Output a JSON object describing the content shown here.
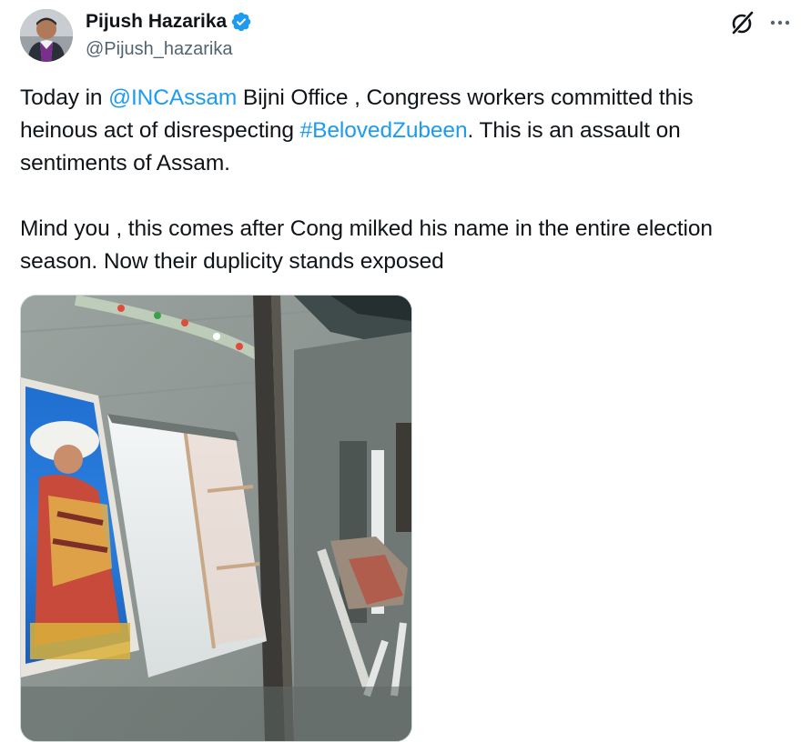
{
  "author": {
    "display_name": "Pijush Hazarika",
    "handle": "@Pijush_hazarika",
    "verified": true
  },
  "header_icons": {
    "grok": "grok-icon",
    "more": "more-options-icon"
  },
  "tweet": {
    "line1_pre": "Today in ",
    "mention": "@INCAssam",
    "line1_post": " Bijni Office , Congress workers committed this",
    "line2_pre": "heinous act of disrespecting ",
    "hashtag": "#BelovedZubeen",
    "line2_post": ". This is an assault on",
    "line3": "sentiments of Assam.",
    "line4": "Mind you , this comes after Cong milked his name in the entire election",
    "line5": "season. Now their duplicity stands exposed"
  },
  "colors": {
    "text": "#0f1419",
    "secondary": "#536471",
    "link": "#1d9bf0",
    "verified": "#1d9bf0"
  }
}
